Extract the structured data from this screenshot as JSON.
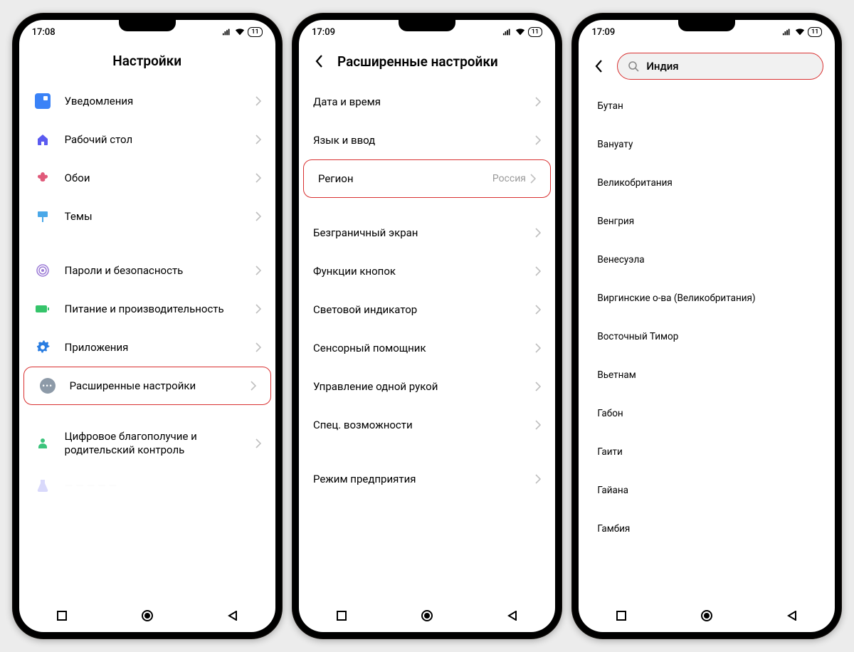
{
  "status": {
    "time1": "17:08",
    "time2": "17:09",
    "time3": "17:09",
    "batt": "11"
  },
  "screen1": {
    "title": "Настройки",
    "rows_a": [
      {
        "label": "Уведомления"
      },
      {
        "label": "Рабочий стол"
      },
      {
        "label": "Обои"
      },
      {
        "label": "Темы"
      }
    ],
    "rows_b": [
      {
        "label": "Пароли и безопасность"
      },
      {
        "label": "Питание и производительность"
      },
      {
        "label": "Приложения"
      },
      {
        "label": "Расширенные настройки"
      }
    ],
    "rows_c": [
      {
        "label": "Цифровое благополучие и родительский контроль"
      }
    ]
  },
  "screen2": {
    "title": "Расширенные настройки",
    "rows_a": [
      {
        "label": "Дата и время"
      },
      {
        "label": "Язык и ввод"
      },
      {
        "label": "Регион",
        "value": "Россия"
      }
    ],
    "rows_b": [
      {
        "label": "Безграничный экран"
      },
      {
        "label": "Функции кнопок"
      },
      {
        "label": "Световой индикатор"
      },
      {
        "label": "Сенсорный помощник"
      },
      {
        "label": "Управление одной рукой"
      },
      {
        "label": "Спец. возможности"
      }
    ],
    "rows_c": [
      {
        "label": "Режим предприятия"
      }
    ]
  },
  "screen3": {
    "search": "Индия",
    "items": [
      "Бутан",
      "Вануату",
      "Великобритания",
      "Венгрия",
      "Венесуэла",
      "Виргинские о-ва (Великобритания)",
      "Восточный Тимор",
      "Вьетнам",
      "Габон",
      "Гаити",
      "Гайана",
      "Гамбия"
    ]
  }
}
